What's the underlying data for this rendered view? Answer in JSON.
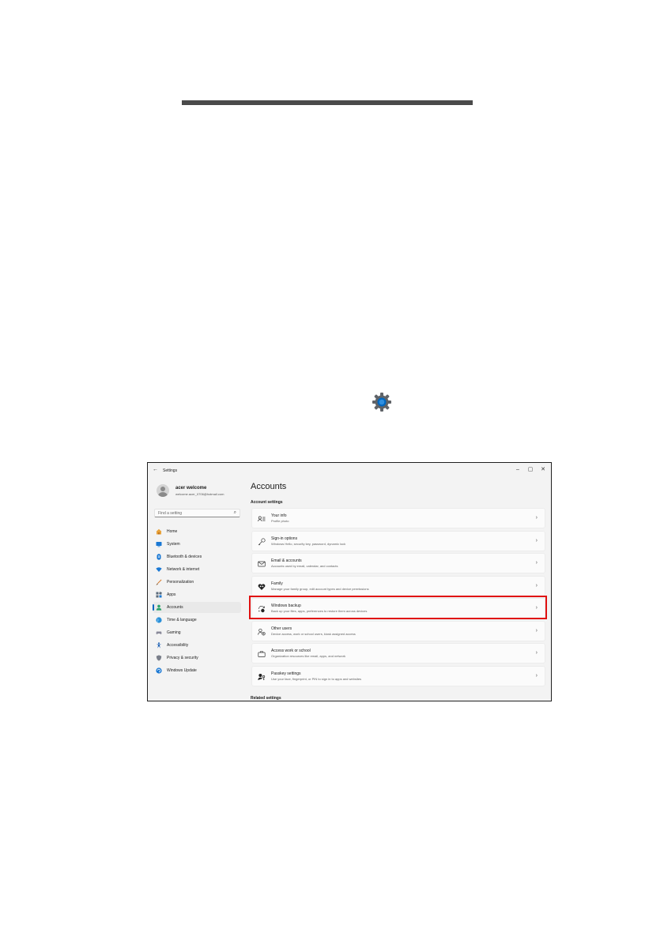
{
  "window": {
    "back_glyph": "←",
    "title": "Settings",
    "minimize": "–",
    "maximize": "▢",
    "close": "✕"
  },
  "user": {
    "name": "acer welcome",
    "email": "welcome.acer_0706@hotmail.com"
  },
  "search": {
    "placeholder": "Find a setting",
    "icon": "search-icon"
  },
  "sidebar": {
    "items": [
      {
        "label": "Home",
        "icon": "home-icon",
        "active": false
      },
      {
        "label": "System",
        "icon": "system-icon",
        "active": false
      },
      {
        "label": "Bluetooth & devices",
        "icon": "bluetooth-icon",
        "active": false
      },
      {
        "label": "Network & internet",
        "icon": "network-icon",
        "active": false
      },
      {
        "label": "Personalization",
        "icon": "brush-icon",
        "active": false
      },
      {
        "label": "Apps",
        "icon": "apps-icon",
        "active": false
      },
      {
        "label": "Accounts",
        "icon": "accounts-icon",
        "active": true
      },
      {
        "label": "Time & language",
        "icon": "globe-icon",
        "active": false
      },
      {
        "label": "Gaming",
        "icon": "gamepad-icon",
        "active": false
      },
      {
        "label": "Accessibility",
        "icon": "accessibility-icon",
        "active": false
      },
      {
        "label": "Privacy & security",
        "icon": "shield-icon",
        "active": false
      },
      {
        "label": "Windows Update",
        "icon": "update-icon",
        "active": false
      }
    ]
  },
  "main": {
    "title": "Accounts",
    "section": "Account settings",
    "cards": [
      {
        "title": "Your info",
        "subtitle": "Profile photo",
        "icon": "person-card-icon"
      },
      {
        "title": "Sign-in options",
        "subtitle": "Windows Hello, security key, password, dynamic lock",
        "icon": "key-icon"
      },
      {
        "title": "Email & accounts",
        "subtitle": "Accounts used by email, calendar, and contacts",
        "icon": "mail-icon"
      },
      {
        "title": "Family",
        "subtitle": "Manage your family group, edit account types and device permissions",
        "icon": "family-icon"
      },
      {
        "title": "Windows backup",
        "subtitle": "Back up your files, apps, preferences to restore them across devices",
        "icon": "backup-icon",
        "highlighted": true
      },
      {
        "title": "Other users",
        "subtitle": "Device access, work or school users, kiosk assigned access",
        "icon": "other-users-icon"
      },
      {
        "title": "Access work or school",
        "subtitle": "Organization resources like email, apps, and network",
        "icon": "briefcase-icon"
      },
      {
        "title": "Passkey settings",
        "subtitle": "Use your face, fingerprint, or PIN to sign in to apps and websites",
        "icon": "passkey-icon"
      }
    ],
    "chevron": "›",
    "related": "Related settings"
  },
  "colors": {
    "accent": "#0067c0",
    "highlight": "#e01010",
    "rule": "#4a4a4a"
  }
}
